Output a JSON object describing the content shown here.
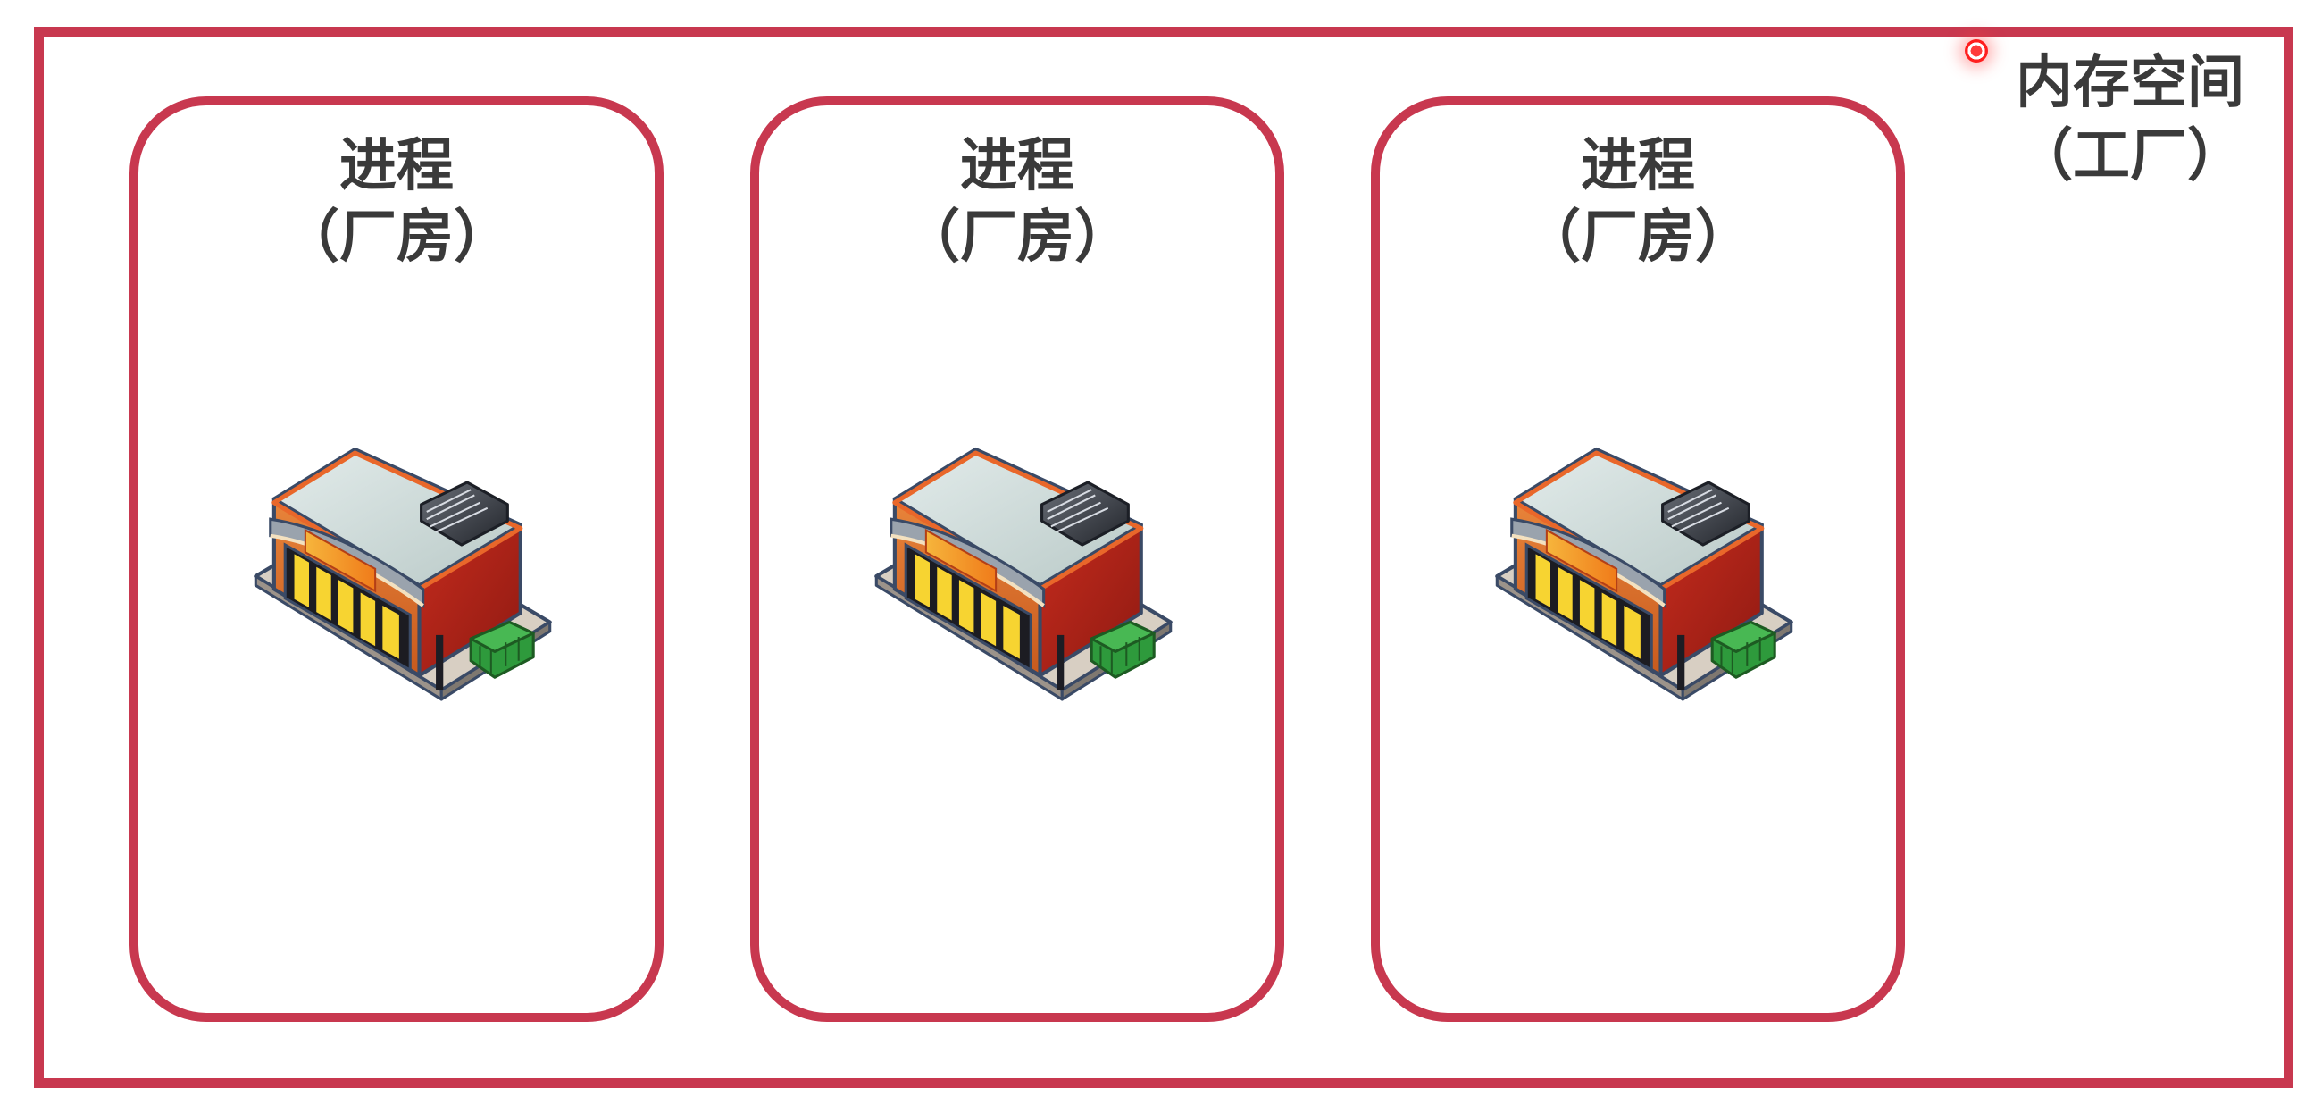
{
  "memory_space": {
    "title": "内存空间",
    "subtitle": "（工厂）"
  },
  "processes": [
    {
      "title": "进程",
      "subtitle": "（厂房）",
      "icon": "building-icon"
    },
    {
      "title": "进程",
      "subtitle": "（厂房）",
      "icon": "building-icon"
    },
    {
      "title": "进程",
      "subtitle": "（厂房）",
      "icon": "building-icon"
    }
  ],
  "colors": {
    "frame": "#c8384f",
    "text": "#3a3a3a",
    "pointer": "#ff2020"
  }
}
